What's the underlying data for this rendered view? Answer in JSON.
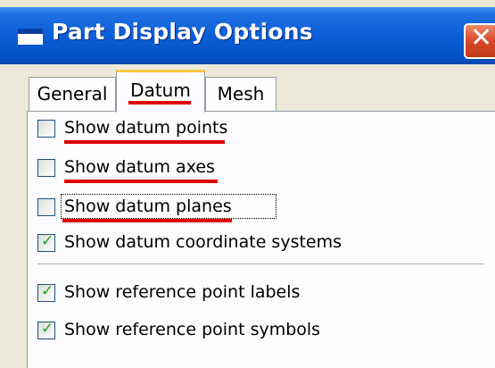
{
  "window": {
    "title": "Part Display Options",
    "close_glyph": "✕",
    "title_icon": "window-icon"
  },
  "tabs": [
    {
      "label": "General",
      "selected": false
    },
    {
      "label": "Datum",
      "selected": true
    },
    {
      "label": "Mesh",
      "selected": false
    }
  ],
  "datum_options": [
    {
      "label": "Show datum points",
      "checked": false
    },
    {
      "label": "Show datum axes",
      "checked": false
    },
    {
      "label": "Show datum planes",
      "checked": false,
      "focused": true
    },
    {
      "label": "Show datum coordinate systems",
      "checked": true
    }
  ],
  "reference_options": [
    {
      "label": "Show reference point labels",
      "checked": true
    },
    {
      "label": "Show reference point symbols",
      "checked": true
    }
  ],
  "check_glyph": "✓",
  "colors": {
    "titlebar": "#0a5ed8",
    "close": "#d9482a",
    "annotation": "#e00000",
    "active_tab_accent": "#ffc83c",
    "check": "#21a121"
  }
}
